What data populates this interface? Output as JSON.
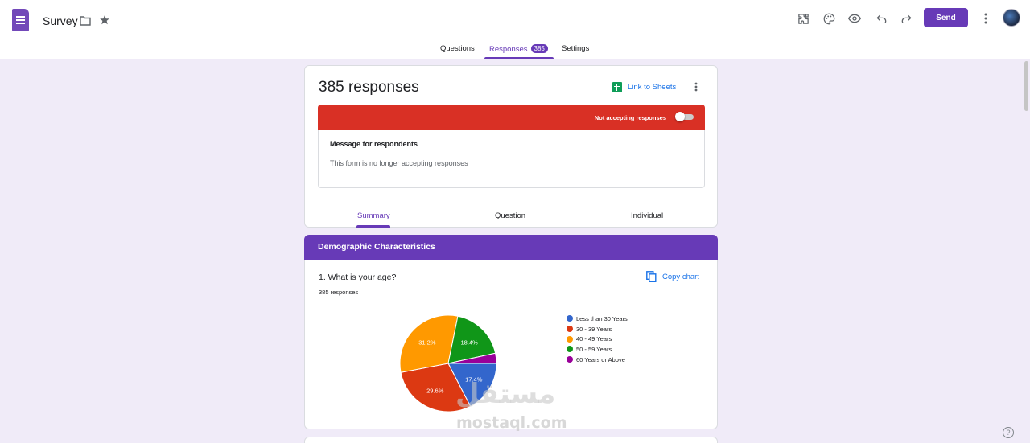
{
  "header": {
    "title": "Survey",
    "send_label": "Send",
    "icons": [
      "folder-icon",
      "star-icon",
      "addon-icon",
      "palette-icon",
      "preview-icon",
      "undo-icon",
      "redo-icon",
      "more-vert-icon"
    ]
  },
  "tabs": [
    {
      "label": "Questions"
    },
    {
      "label": "Responses",
      "badge": "385"
    },
    {
      "label": "Settings"
    }
  ],
  "responses_card": {
    "count_label": "385 responses",
    "link_sheets": "Link to Sheets",
    "accepting_label": "Not accepting responses",
    "accepting": false,
    "message_label": "Message for respondents",
    "message_text": "This form is no longer accepting responses",
    "sub_tabs": [
      "Summary",
      "Question",
      "Individual"
    ],
    "active_sub_tab": "Summary"
  },
  "section": {
    "title": "Demographic Characteristics"
  },
  "question_card": {
    "question": "1. What is your age?",
    "responses": "385 responses",
    "copy_chart": "Copy chart"
  },
  "chart_data": {
    "type": "pie",
    "categories": [
      "Less than 30 Years",
      "30 - 39 Years",
      "40 - 49 Years",
      "50 - 59 Years",
      "60 Years or Above"
    ],
    "values": [
      17.4,
      29.6,
      31.2,
      18.4,
      3.4
    ],
    "data_labels": [
      "17.4%",
      "29.6%",
      "31.2%",
      "18.4%",
      ""
    ],
    "colors": [
      "#3366cc",
      "#dc3912",
      "#ff9900",
      "#109618",
      "#990099"
    ],
    "legend_position": "right"
  },
  "watermark": {
    "arabic": "مستقل",
    "latin": "mostaql.com"
  },
  "colors": {
    "accent": "#673ab7",
    "danger": "#d93025",
    "background": "#f0ebf8",
    "link": "#1a73e8"
  }
}
